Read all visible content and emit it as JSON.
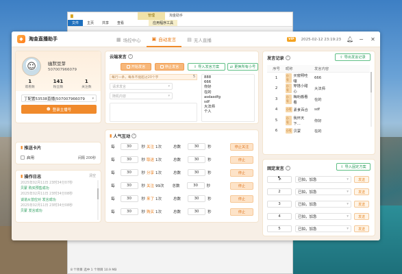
{
  "explorer": {
    "tool_tab": "管理",
    "app_title": "淘金助手",
    "ribbon": [
      "文件",
      "主页",
      "共享",
      "查看",
      "应用程序工具"
    ],
    "status": "8 个项目   选中 1 个项目 10.9 MB"
  },
  "app": {
    "title": "淘金直播助手",
    "tabs": [
      {
        "label": "场控中心",
        "icon": "grid-icon"
      },
      {
        "label": "自动发言",
        "icon": "chat-icon"
      },
      {
        "label": "无人直播",
        "icon": "video-icon"
      }
    ],
    "vip_badge": "VIP",
    "expiry": "2025-02-12 23:19:23"
  },
  "profile": {
    "name": "幽默豆芽",
    "id": "507007966079",
    "stats": [
      {
        "value": "1",
        "label": "观看数"
      },
      {
        "value": "141",
        "label": "粉丝数"
      },
      {
        "value": "1",
        "label": "关注数"
      }
    ],
    "room_select": "丁配置53538直播|507007966079",
    "login_button": "登录主播号"
  },
  "push_card": {
    "title": "推送卡片",
    "enable_label": "启用",
    "interval": "间隔 200秒"
  },
  "log": {
    "title": "操作日志",
    "clear": "清空",
    "lines": [
      {
        "text": "2025年02月11日 23时34分07秒",
        "color": "#aaaaaa"
      },
      {
        "text": "贝蒙 购买预售成功",
        "color": "#2a9d5c"
      },
      {
        "text": "2025年02月11日 23时34分08秒",
        "color": "#aaaaaa"
      },
      {
        "text": "谈道从曾应对 发言成功",
        "color": "#2a9d5c"
      },
      {
        "text": "2025年02月11日 23时34分08秒",
        "color": "#aaaaaa"
      },
      {
        "text": "贝蒙 发言成功",
        "color": "#2a9d5c"
      }
    ]
  },
  "cloud": {
    "title": "云端发言",
    "start": "开始发言",
    "stop": "停止发言",
    "import": "导入发言方案",
    "switch": "更换所有小号",
    "input_hint": "每行一条，每条不能超过20个字",
    "input_count": "5",
    "select1": "请求发言",
    "select2": "随机内容",
    "messages": [
      "888",
      "666",
      "你好",
      "在的",
      "asdasdfg",
      "sdf",
      "大法师",
      "个人"
    ]
  },
  "interact": {
    "title": "人气互动",
    "rows": [
      {
        "pre": "每",
        "n1": "30",
        "unit": "秒",
        "action": "关注",
        "count": "1次",
        "total_label": "总数",
        "total": "30",
        "button": "停止关注"
      },
      {
        "pre": "每",
        "n1": "30",
        "unit": "秒",
        "action": "取送",
        "count": "1次",
        "total_label": "总数",
        "total": "30",
        "button": "停止"
      },
      {
        "pre": "每",
        "n1": "30",
        "unit": "秒",
        "action": "分享",
        "count": "1次",
        "total_label": "总数",
        "total": "30",
        "button": "停止"
      },
      {
        "pre": "每",
        "n1": "30",
        "unit": "秒",
        "action": "关注",
        "count": "99次",
        "total_label": "总数",
        "total": "30",
        "button": "停止"
      },
      {
        "pre": "每",
        "n1": "30",
        "unit": "秒",
        "action": "来了",
        "count": "1次",
        "total_label": "总数",
        "total": "30",
        "button": "停止"
      },
      {
        "pre": "每",
        "n1": "30",
        "unit": "秒",
        "action": "购买",
        "count": "1次",
        "total_label": "总数",
        "total": "30",
        "button": "停止"
      }
    ]
  },
  "record": {
    "title": "发言记录",
    "export": "导出发言记录",
    "headers": [
      "序号",
      "昵称",
      "发言内容"
    ],
    "rows": [
      {
        "no": "1",
        "tag": "小号",
        "name": "买窗照哇噻",
        "content": "666"
      },
      {
        "no": "2",
        "tag": "小号",
        "name": "穿搭小甜心",
        "content": "大法师"
      },
      {
        "no": "3",
        "tag": "小号",
        "name": "梅劝搬看看",
        "content": "在的"
      },
      {
        "no": "4",
        "tag": "小号",
        "name": "素食百合",
        "content": "sdf"
      },
      {
        "no": "5",
        "tag": "小号",
        "name": "我怀天下...",
        "content": "你好"
      },
      {
        "no": "6",
        "tag": "小号",
        "name": "贝蒙",
        "content": "在的"
      }
    ]
  },
  "fixed": {
    "title": "固定发言",
    "import": "导入固定方案",
    "rows": [
      {
        "num": "1",
        "text": "已拍，加急",
        "btn": "发送"
      },
      {
        "num": "2",
        "text": "已拍，加急",
        "btn": "发送"
      },
      {
        "num": "3",
        "text": "已拍，加急",
        "btn": "发送"
      },
      {
        "num": "4",
        "text": "已拍，加急",
        "btn": "发送"
      },
      {
        "num": "5",
        "text": "已拍，加急",
        "btn": "发送"
      }
    ]
  }
}
